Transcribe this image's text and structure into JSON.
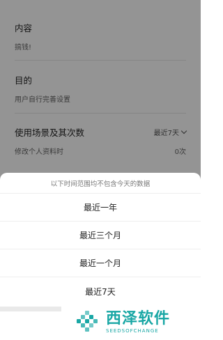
{
  "background": {
    "content": {
      "label": "内容",
      "value": "搞钱!"
    },
    "purpose": {
      "label": "目的",
      "value": "用户自行完善设置"
    },
    "usage": {
      "label": "使用场景及其次数",
      "range_selector": "最近7天",
      "scene": "修改个人资料时",
      "count": "0次"
    }
  },
  "sheet": {
    "header": "以下时间范围均不包含今天的数据",
    "options": [
      "最近一年",
      "最近三个月",
      "最近一个月",
      "最近7天"
    ]
  },
  "watermark": {
    "title": "西泽软件",
    "subtitle": "SEEDSOFCHANGE",
    "color": "#19a7a5"
  },
  "colors": {
    "overlay": "rgba(0,0,0,0.42)",
    "accent": "#19a7a5"
  }
}
